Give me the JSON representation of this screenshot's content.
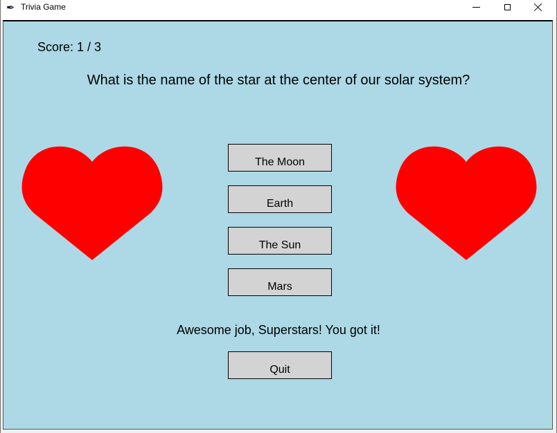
{
  "window": {
    "title": "Trivia Game",
    "icon": "feather-icon"
  },
  "game": {
    "score_text": "Score: 1 / 3",
    "question": "What is the name of the star at the center of our solar system?",
    "answers": [
      "The Moon",
      "Earth",
      "The Sun",
      "Mars"
    ],
    "feedback": "Awesome job, Superstars! You got it!",
    "quit_label": "Quit"
  },
  "colors": {
    "background": "#add8e6",
    "heart": "#ff0000",
    "button": "#d3d3d3"
  }
}
